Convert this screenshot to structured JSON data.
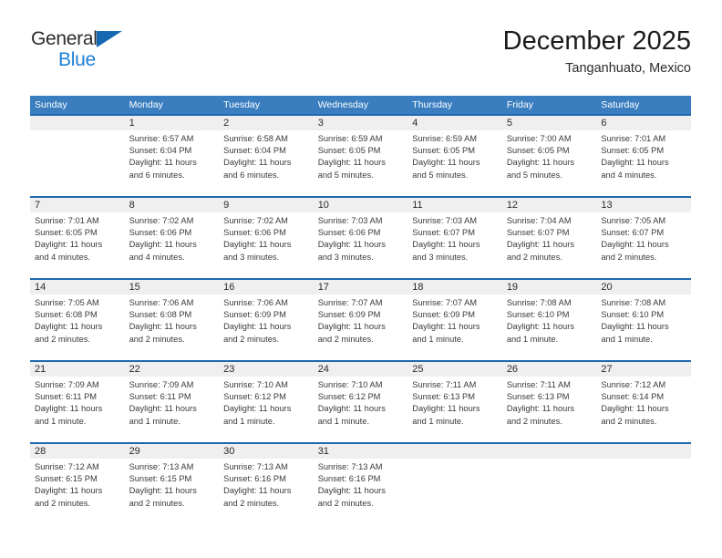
{
  "brand": {
    "line1": "General",
    "line2": "Blue",
    "triangle_icon": "brand-triangle-icon",
    "accent_dark": "#1668b3",
    "accent_light": "#1c7fd6"
  },
  "header": {
    "title": "December 2025",
    "subtitle": "Tanganhuato, Mexico"
  },
  "theme": {
    "header_blue": "#3a7ebf",
    "rule_blue": "#1f68ad",
    "numband_gray": "#efefef"
  },
  "calendar": {
    "weekday_headers": [
      "Sunday",
      "Monday",
      "Tuesday",
      "Wednesday",
      "Thursday",
      "Friday",
      "Saturday"
    ],
    "weeks": [
      {
        "days": [
          {
            "num": "",
            "lines": []
          },
          {
            "num": "1",
            "lines": [
              "Sunrise: 6:57 AM",
              "Sunset: 6:04 PM",
              "Daylight: 11 hours",
              "and 6 minutes."
            ]
          },
          {
            "num": "2",
            "lines": [
              "Sunrise: 6:58 AM",
              "Sunset: 6:04 PM",
              "Daylight: 11 hours",
              "and 6 minutes."
            ]
          },
          {
            "num": "3",
            "lines": [
              "Sunrise: 6:59 AM",
              "Sunset: 6:05 PM",
              "Daylight: 11 hours",
              "and 5 minutes."
            ]
          },
          {
            "num": "4",
            "lines": [
              "Sunrise: 6:59 AM",
              "Sunset: 6:05 PM",
              "Daylight: 11 hours",
              "and 5 minutes."
            ]
          },
          {
            "num": "5",
            "lines": [
              "Sunrise: 7:00 AM",
              "Sunset: 6:05 PM",
              "Daylight: 11 hours",
              "and 5 minutes."
            ]
          },
          {
            "num": "6",
            "lines": [
              "Sunrise: 7:01 AM",
              "Sunset: 6:05 PM",
              "Daylight: 11 hours",
              "and 4 minutes."
            ]
          }
        ]
      },
      {
        "days": [
          {
            "num": "7",
            "lines": [
              "Sunrise: 7:01 AM",
              "Sunset: 6:05 PM",
              "Daylight: 11 hours",
              "and 4 minutes."
            ]
          },
          {
            "num": "8",
            "lines": [
              "Sunrise: 7:02 AM",
              "Sunset: 6:06 PM",
              "Daylight: 11 hours",
              "and 4 minutes."
            ]
          },
          {
            "num": "9",
            "lines": [
              "Sunrise: 7:02 AM",
              "Sunset: 6:06 PM",
              "Daylight: 11 hours",
              "and 3 minutes."
            ]
          },
          {
            "num": "10",
            "lines": [
              "Sunrise: 7:03 AM",
              "Sunset: 6:06 PM",
              "Daylight: 11 hours",
              "and 3 minutes."
            ]
          },
          {
            "num": "11",
            "lines": [
              "Sunrise: 7:03 AM",
              "Sunset: 6:07 PM",
              "Daylight: 11 hours",
              "and 3 minutes."
            ]
          },
          {
            "num": "12",
            "lines": [
              "Sunrise: 7:04 AM",
              "Sunset: 6:07 PM",
              "Daylight: 11 hours",
              "and 2 minutes."
            ]
          },
          {
            "num": "13",
            "lines": [
              "Sunrise: 7:05 AM",
              "Sunset: 6:07 PM",
              "Daylight: 11 hours",
              "and 2 minutes."
            ]
          }
        ]
      },
      {
        "days": [
          {
            "num": "14",
            "lines": [
              "Sunrise: 7:05 AM",
              "Sunset: 6:08 PM",
              "Daylight: 11 hours",
              "and 2 minutes."
            ]
          },
          {
            "num": "15",
            "lines": [
              "Sunrise: 7:06 AM",
              "Sunset: 6:08 PM",
              "Daylight: 11 hours",
              "and 2 minutes."
            ]
          },
          {
            "num": "16",
            "lines": [
              "Sunrise: 7:06 AM",
              "Sunset: 6:09 PM",
              "Daylight: 11 hours",
              "and 2 minutes."
            ]
          },
          {
            "num": "17",
            "lines": [
              "Sunrise: 7:07 AM",
              "Sunset: 6:09 PM",
              "Daylight: 11 hours",
              "and 2 minutes."
            ]
          },
          {
            "num": "18",
            "lines": [
              "Sunrise: 7:07 AM",
              "Sunset: 6:09 PM",
              "Daylight: 11 hours",
              "and 1 minute."
            ]
          },
          {
            "num": "19",
            "lines": [
              "Sunrise: 7:08 AM",
              "Sunset: 6:10 PM",
              "Daylight: 11 hours",
              "and 1 minute."
            ]
          },
          {
            "num": "20",
            "lines": [
              "Sunrise: 7:08 AM",
              "Sunset: 6:10 PM",
              "Daylight: 11 hours",
              "and 1 minute."
            ]
          }
        ]
      },
      {
        "days": [
          {
            "num": "21",
            "lines": [
              "Sunrise: 7:09 AM",
              "Sunset: 6:11 PM",
              "Daylight: 11 hours",
              "and 1 minute."
            ]
          },
          {
            "num": "22",
            "lines": [
              "Sunrise: 7:09 AM",
              "Sunset: 6:11 PM",
              "Daylight: 11 hours",
              "and 1 minute."
            ]
          },
          {
            "num": "23",
            "lines": [
              "Sunrise: 7:10 AM",
              "Sunset: 6:12 PM",
              "Daylight: 11 hours",
              "and 1 minute."
            ]
          },
          {
            "num": "24",
            "lines": [
              "Sunrise: 7:10 AM",
              "Sunset: 6:12 PM",
              "Daylight: 11 hours",
              "and 1 minute."
            ]
          },
          {
            "num": "25",
            "lines": [
              "Sunrise: 7:11 AM",
              "Sunset: 6:13 PM",
              "Daylight: 11 hours",
              "and 1 minute."
            ]
          },
          {
            "num": "26",
            "lines": [
              "Sunrise: 7:11 AM",
              "Sunset: 6:13 PM",
              "Daylight: 11 hours",
              "and 2 minutes."
            ]
          },
          {
            "num": "27",
            "lines": [
              "Sunrise: 7:12 AM",
              "Sunset: 6:14 PM",
              "Daylight: 11 hours",
              "and 2 minutes."
            ]
          }
        ]
      },
      {
        "days": [
          {
            "num": "28",
            "lines": [
              "Sunrise: 7:12 AM",
              "Sunset: 6:15 PM",
              "Daylight: 11 hours",
              "and 2 minutes."
            ]
          },
          {
            "num": "29",
            "lines": [
              "Sunrise: 7:13 AM",
              "Sunset: 6:15 PM",
              "Daylight: 11 hours",
              "and 2 minutes."
            ]
          },
          {
            "num": "30",
            "lines": [
              "Sunrise: 7:13 AM",
              "Sunset: 6:16 PM",
              "Daylight: 11 hours",
              "and 2 minutes."
            ]
          },
          {
            "num": "31",
            "lines": [
              "Sunrise: 7:13 AM",
              "Sunset: 6:16 PM",
              "Daylight: 11 hours",
              "and 2 minutes."
            ]
          },
          {
            "num": "",
            "lines": []
          },
          {
            "num": "",
            "lines": []
          },
          {
            "num": "",
            "lines": []
          }
        ]
      }
    ]
  }
}
